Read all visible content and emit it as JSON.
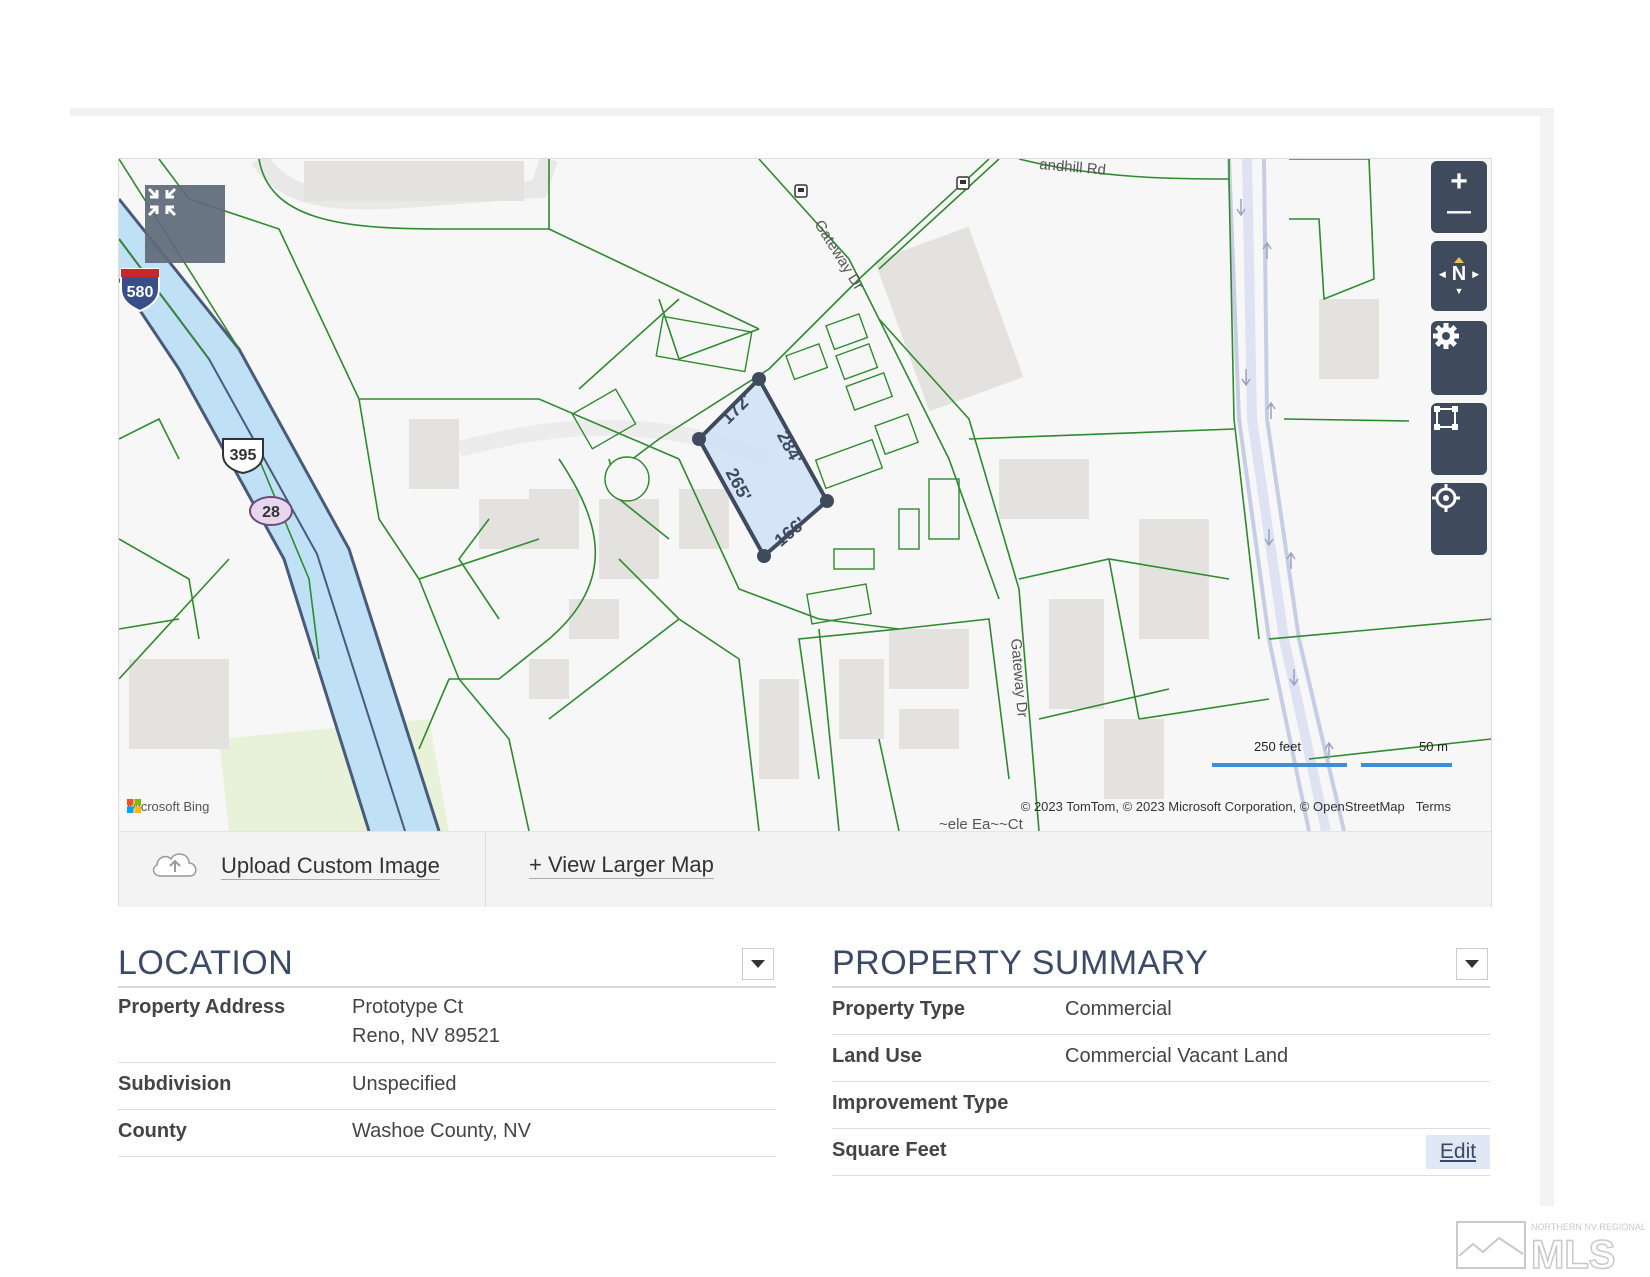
{
  "map": {
    "streets": {
      "sandhill": "andhill Rd",
      "gateway_upper": "Gateway Dr",
      "gateway_lower": "Gateway Dr",
      "bottom_fragment": "~ele Ea~~Ct"
    },
    "highway_shields": {
      "i580": "580",
      "us395": "395",
      "sr28": "28"
    },
    "parcel_dimensions": {
      "side_a": "172'",
      "side_b": "284'",
      "side_c": "166'",
      "side_d": "265'"
    },
    "scale": {
      "feet_label": "250 feet",
      "meters_label": "50 m"
    },
    "bing_label": "Microsoft Bing",
    "copyright": "© 2023 TomTom, © 2023 Microsoft Corporation, © OpenStreetMap",
    "terms_label": "Terms",
    "controls": {
      "zoom_in": "+",
      "zoom_out": "—",
      "compass": "N"
    },
    "colors": {
      "parcel_line": "#2e8b2e",
      "highway": "#bfe0f5",
      "selection_fill": "#cfe2f7",
      "selection_stroke": "#3f4b5c"
    }
  },
  "map_footer": {
    "upload_label": "Upload Custom Image",
    "larger_map_label": "+ View Larger Map"
  },
  "location": {
    "title": "LOCATION",
    "rows": [
      {
        "label": "Property Address",
        "line1": "Prototype Ct",
        "line2": "Reno, NV 89521"
      },
      {
        "label": "Subdivision",
        "value": "Unspecified"
      },
      {
        "label": "County",
        "value": "Washoe County, NV"
      }
    ]
  },
  "property_summary": {
    "title": "PROPERTY SUMMARY",
    "rows": [
      {
        "label": "Property Type",
        "value": "Commercial"
      },
      {
        "label": "Land Use",
        "value": "Commercial Vacant Land"
      },
      {
        "label": "Improvement Type",
        "value": ""
      },
      {
        "label": "Square Feet",
        "value": ""
      }
    ],
    "edit_label": "Edit"
  },
  "watermark": {
    "top_text": "NORTHERN NV REGIONAL",
    "mls_text": "MLS"
  }
}
